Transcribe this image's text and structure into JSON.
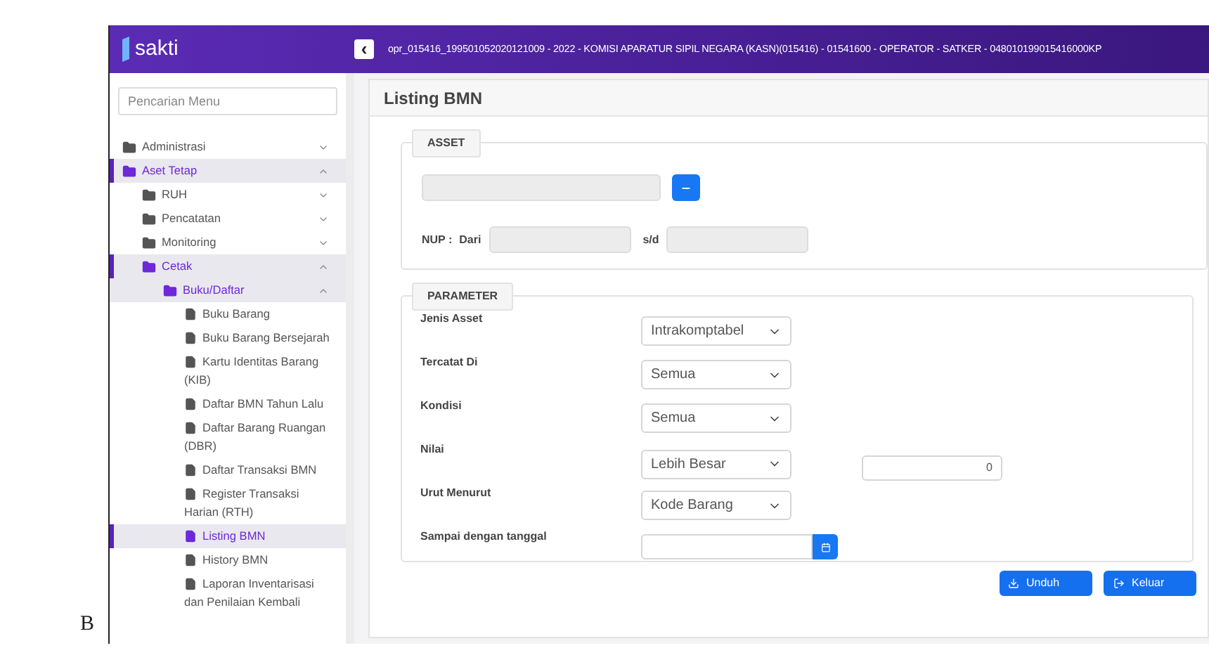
{
  "figure_label": "B",
  "header": {
    "logo": "sakti",
    "collapse_icon": "‹",
    "user_info": "opr_015416_199501052020121009 - 2022 - KOMISI APARATUR SIPIL NEGARA (KASN)(015416) - 01541600 - OPERATOR - SATKER - 048010199015416000KP"
  },
  "sidebar": {
    "search": {
      "placeholder": "Pencarian Menu"
    },
    "items": [
      {
        "label": "Administrasi",
        "expanded": false
      },
      {
        "label": "Aset Tetap",
        "expanded": true,
        "children": [
          {
            "label": "RUH",
            "expanded": false
          },
          {
            "label": "Pencatatan",
            "expanded": false
          },
          {
            "label": "Monitoring",
            "expanded": false
          },
          {
            "label": "Cetak",
            "expanded": true,
            "children": [
              {
                "label": "Buku/Daftar",
                "expanded": true,
                "children": [
                  {
                    "label": "Buku Barang",
                    "selected": false
                  },
                  {
                    "label": "Buku Barang Bersejarah",
                    "selected": false
                  },
                  {
                    "label": "Kartu Identitas Barang (KIB)",
                    "selected": false
                  },
                  {
                    "label": "Daftar BMN Tahun Lalu",
                    "selected": false
                  },
                  {
                    "label": "Daftar Barang Ruangan (DBR)",
                    "selected": false
                  },
                  {
                    "label": "Daftar Transaksi BMN",
                    "selected": false
                  },
                  {
                    "label": "Register Transaksi Harian (RTH)",
                    "selected": false
                  },
                  {
                    "label": "Listing BMN",
                    "selected": true
                  },
                  {
                    "label": "History BMN",
                    "selected": false
                  },
                  {
                    "label": "Laporan Inventarisasi dan Penilaian Kembali",
                    "selected": false
                  }
                ]
              }
            ]
          }
        ]
      }
    ]
  },
  "page": {
    "title": "Listing BMN",
    "asset": {
      "legend": "ASSET",
      "nup_label": "NUP :",
      "from_label": "Dari",
      "to_label": "s/d"
    },
    "parameter": {
      "legend": "PARAMETER",
      "rows": [
        {
          "label": "Jenis Asset",
          "kind": "select",
          "value": "Intrakomptabel"
        },
        {
          "label": "Tercatat Di",
          "kind": "select",
          "value": "Semua"
        },
        {
          "label": "Kondisi",
          "kind": "select",
          "value": "Semua"
        },
        {
          "label": "Nilai",
          "kind": "select",
          "value": "Lebih Besar",
          "extra_value": "0"
        },
        {
          "label": "Urut Menurut",
          "kind": "select",
          "value": "Kode Barang"
        },
        {
          "label": "Sampai dengan tanggal",
          "kind": "date"
        }
      ]
    },
    "buttons": [
      {
        "label": "Unduh",
        "kind": "download"
      },
      {
        "label": "Keluar",
        "kind": "exit"
      }
    ]
  }
}
